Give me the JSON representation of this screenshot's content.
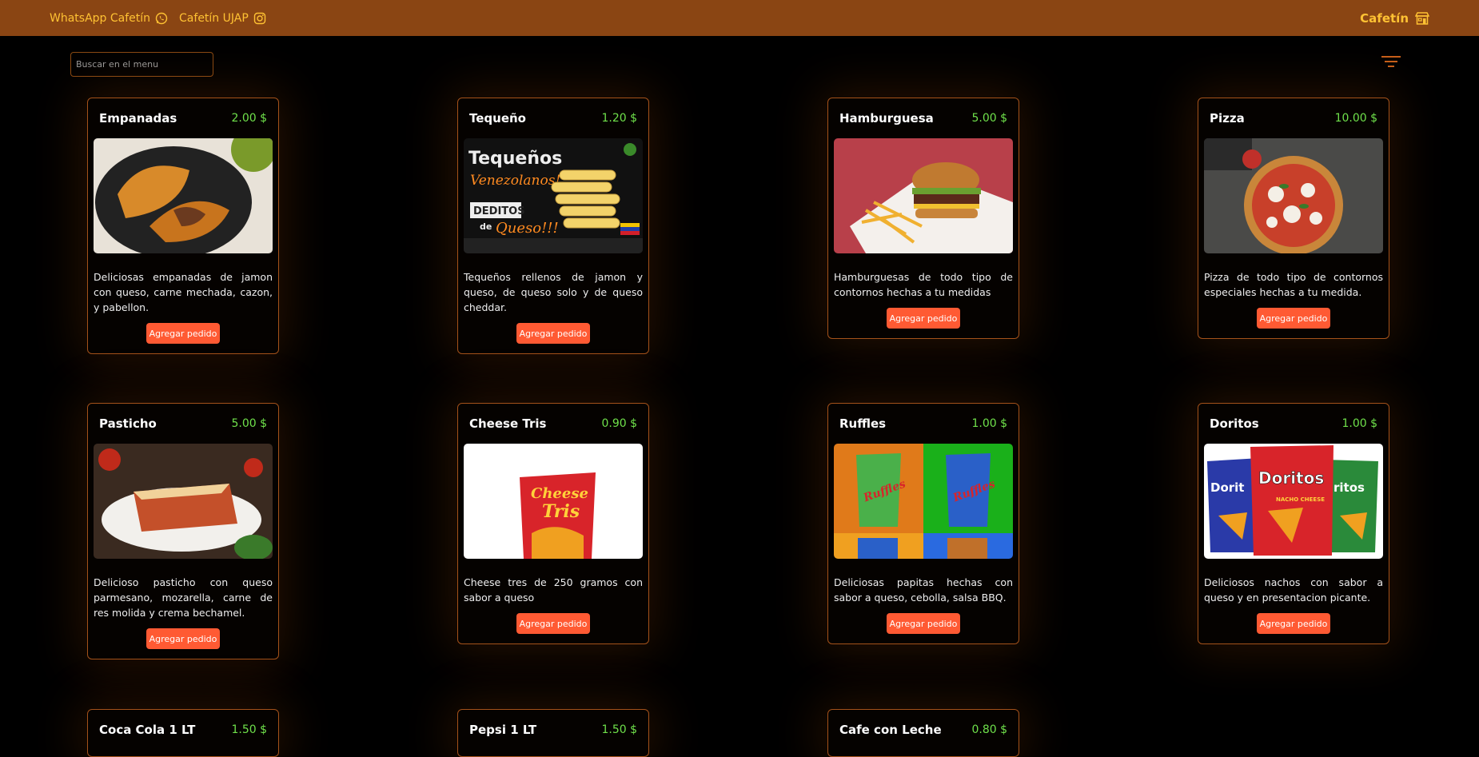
{
  "topbar": {
    "whatsapp_label": "WhatsApp Cafetín",
    "instagram_label": "Cafetín UJAP",
    "brand": "Cafetín"
  },
  "search": {
    "placeholder": "Buscar en el menu"
  },
  "products": [
    {
      "name": "Empanadas",
      "price": "2.00 $",
      "desc": "Deliciosas empanadas de jamon con queso, carne mechada, cazon, y pabellon.",
      "button": "Agregar pedido"
    },
    {
      "name": "Tequeño",
      "price": "1.20 $",
      "desc": "Tequeños rellenos de jamon y queso, de queso solo y de queso cheddar.",
      "button": "Agregar pedido",
      "image_text": [
        "Tequeños",
        "Venezolanos!",
        "DEDITOS",
        "de",
        "Queso!!!"
      ]
    },
    {
      "name": "Hamburguesa",
      "price": "5.00 $",
      "desc": "Hamburguesas de todo tipo de contornos hechas a tu medidas",
      "button": "Agregar pedido"
    },
    {
      "name": "Pizza",
      "price": "10.00 $",
      "desc": "Pizza de todo tipo de contornos especiales hechas a tu medida.",
      "button": "Agregar pedido"
    },
    {
      "name": "Pasticho",
      "price": "5.00 $",
      "desc": "Delicioso pasticho con queso parmesano, mozarella, carne de res molida y crema bechamel.",
      "button": "Agregar pedido"
    },
    {
      "name": "Cheese Tris",
      "price": "0.90 $",
      "desc": "Cheese tres de 250 gramos con sabor a queso",
      "button": "Agregar pedido",
      "image_text": [
        "Cheese",
        "Tris"
      ]
    },
    {
      "name": "Ruffles",
      "price": "1.00 $",
      "desc": "Deliciosas papitas hechas con sabor a queso, cebolla, salsa BBQ.",
      "button": "Agregar pedido",
      "image_text": [
        "Ruffles",
        "Ruffles"
      ]
    },
    {
      "name": "Doritos",
      "price": "1.00 $",
      "desc": "Deliciosos nachos con sabor a queso y en presentacion picante.",
      "button": "Agregar pedido",
      "image_text": [
        "Dorit",
        "Doritos",
        "NACHO CHEESE",
        "ritos"
      ]
    },
    {
      "name": "Coca Cola 1 LT",
      "price": "1.50 $"
    },
    {
      "name": "Pepsi 1 LT",
      "price": "1.50 $"
    },
    {
      "name": "Cafe con Leche",
      "price": "0.80 $"
    }
  ],
  "colors": {
    "topbar": "#8a4513",
    "accent": "#ffc233",
    "price": "#6fe04a",
    "button": "#ff5a33",
    "border": "#a4521a"
  }
}
